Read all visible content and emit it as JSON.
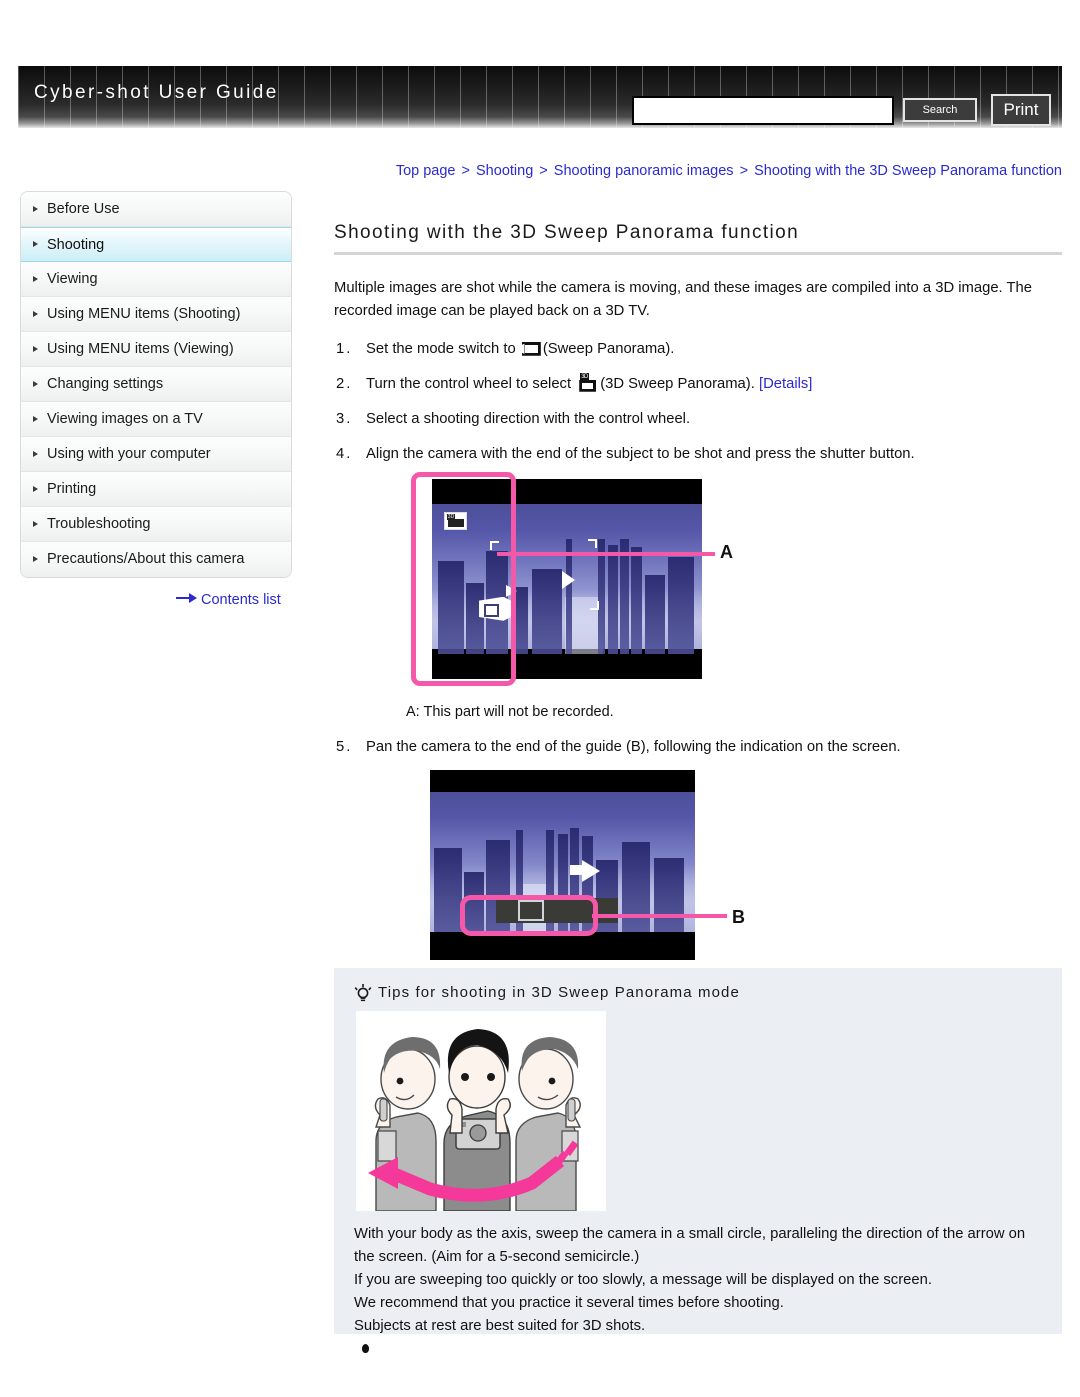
{
  "header": {
    "title": "Cyber-shot User Guide",
    "search_value": "",
    "search_placeholder": "",
    "search_label": "Search",
    "print_label": "Print"
  },
  "breadcrumb": {
    "items": [
      "Top page",
      "Shooting",
      "Shooting panoramic images",
      "Shooting with the 3D Sweep Panorama function"
    ],
    "separator": ">"
  },
  "sidebar": {
    "items": [
      {
        "label": "Before Use",
        "active": false
      },
      {
        "label": "Shooting",
        "active": true
      },
      {
        "label": "Viewing",
        "active": false
      },
      {
        "label": "Using MENU items (Shooting)",
        "active": false
      },
      {
        "label": "Using MENU items (Viewing)",
        "active": false
      },
      {
        "label": "Changing settings",
        "active": false
      },
      {
        "label": "Viewing images on a TV",
        "active": false
      },
      {
        "label": "Using with your computer",
        "active": false
      },
      {
        "label": "Printing",
        "active": false
      },
      {
        "label": "Troubleshooting",
        "active": false
      },
      {
        "label": "Precautions/About this camera",
        "active": false
      }
    ],
    "contents_list_label": "Contents list"
  },
  "main": {
    "page_title": "Shooting with the 3D Sweep Panorama function",
    "intro": "Multiple images are shot while the camera is moving, and these images are compiled into a 3D image. The recorded image can be played back on a 3D TV.",
    "steps": [
      {
        "num": "1.",
        "text_before": "Set the mode switch to",
        "icon": "sweep-panorama-icon",
        "text_after": "(Sweep Panorama).",
        "link": ""
      },
      {
        "num": "2.",
        "text_before": "Turn the control wheel to select",
        "icon": "3d-sweep-panorama-icon",
        "text_after": "(3D Sweep Panorama).",
        "link": "[Details]"
      },
      {
        "num": "3.",
        "text_before": "Select a shooting direction with the control wheel.",
        "icon": "",
        "text_after": "",
        "link": ""
      },
      {
        "num": "4.",
        "text_before": "Align the camera with the end of the subject to be shot and press the shutter button.",
        "icon": "",
        "text_after": "",
        "link": ""
      },
      {
        "num": "5.",
        "text_before": "Pan the camera to the end of the guide (B), following the indication on the screen.",
        "icon": "",
        "text_after": "",
        "link": ""
      }
    ],
    "figure_a_label": "A",
    "figure_a_caption": "A: This part will not be recorded.",
    "figure_b_label": "B"
  },
  "tips": {
    "heading": "Tips for shooting in 3D Sweep Panorama mode",
    "lines": [
      "With your body as the axis, sweep the camera in a small circle, paralleling the direction of the arrow on the screen. (Aim for a 5-second semicircle.)",
      "If you are sweeping too quickly or too slowly, a message will be displayed on the screen.",
      "We recommend that you practice it several times before shooting.",
      "Subjects at rest are best suited for 3D shots."
    ]
  },
  "colors": {
    "link": "#2a2ad0",
    "accent_pink": "#f558a8",
    "tips_bg": "#ebeef3",
    "sidebar_active": "#cceef6"
  }
}
